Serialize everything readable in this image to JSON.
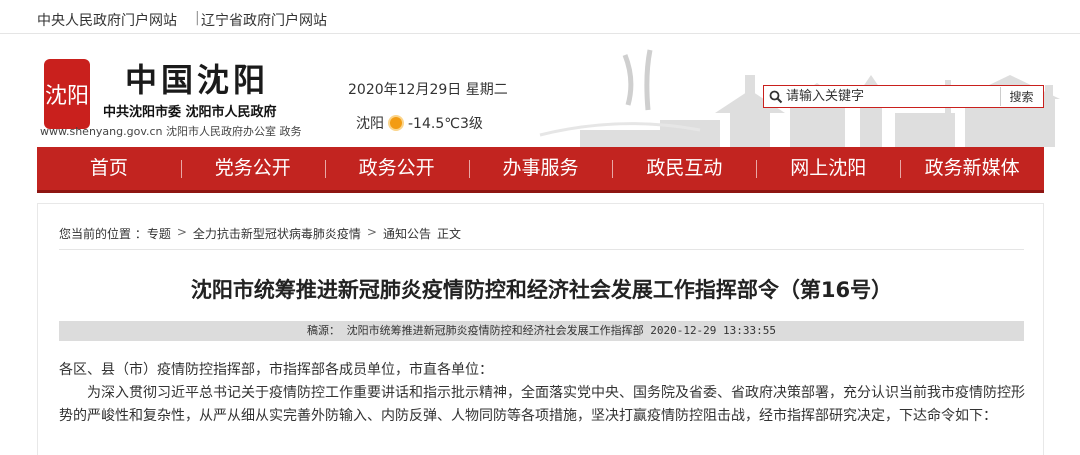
{
  "topbar": {
    "link1": "中央人民政府门户网站",
    "link2": "辽宁省政府门户网站",
    "separator": "|"
  },
  "header": {
    "seal_text": "沈阳",
    "title": "中国沈阳",
    "subtitle": "中共沈阳市委  沈阳市人民政府",
    "url_line": "www.shenyang.gov.cn 沈阳市人民政府办公室 政务",
    "date": "2020年12月29日 星期二",
    "city": "沈阳",
    "temperature": "-14.5℃3级",
    "weather_icon": "sun-icon"
  },
  "search": {
    "placeholder": "请输入关键字",
    "button": "搜索",
    "accent": "#c9201d"
  },
  "nav": {
    "items": [
      "首页",
      "党务公开",
      "政务公开",
      "办事服务",
      "政民互动",
      "网上沈阳",
      "政务新媒体"
    ],
    "bg": "#c22420"
  },
  "breadcrumb": {
    "prefix": "您当前的位置 ：专题",
    "level2": "全力抗击新型冠状病毒肺炎疫情",
    "level3": "通知公告",
    "level4": "正文",
    "arrow": ">"
  },
  "article": {
    "title": "沈阳市统筹推进新冠肺炎疫情防控和经济社会发展工作指挥部令（第16号）",
    "source_label": "稿源：",
    "source": "沈阳市统筹推进新冠肺炎疫情防控和经济社会发展工作指挥部",
    "datetime": "2020-12-29 13:33:55",
    "para1": "各区、县（市）疫情防控指挥部，市指挥部各成员单位，市直各单位：",
    "para2": "为深入贯彻习近平总书记关于疫情防控工作重要讲话和指示批示精神，全面落实党中央、国务院及省委、省政府决策部署，充分认识当前我市疫情防控形势的严峻性和复杂性，从严从细从实完善外防输入、内防反弹、人物同防等各项措施，坚决打赢疫情防控阻击战，经市指挥部研究决定，下达命令如下："
  }
}
